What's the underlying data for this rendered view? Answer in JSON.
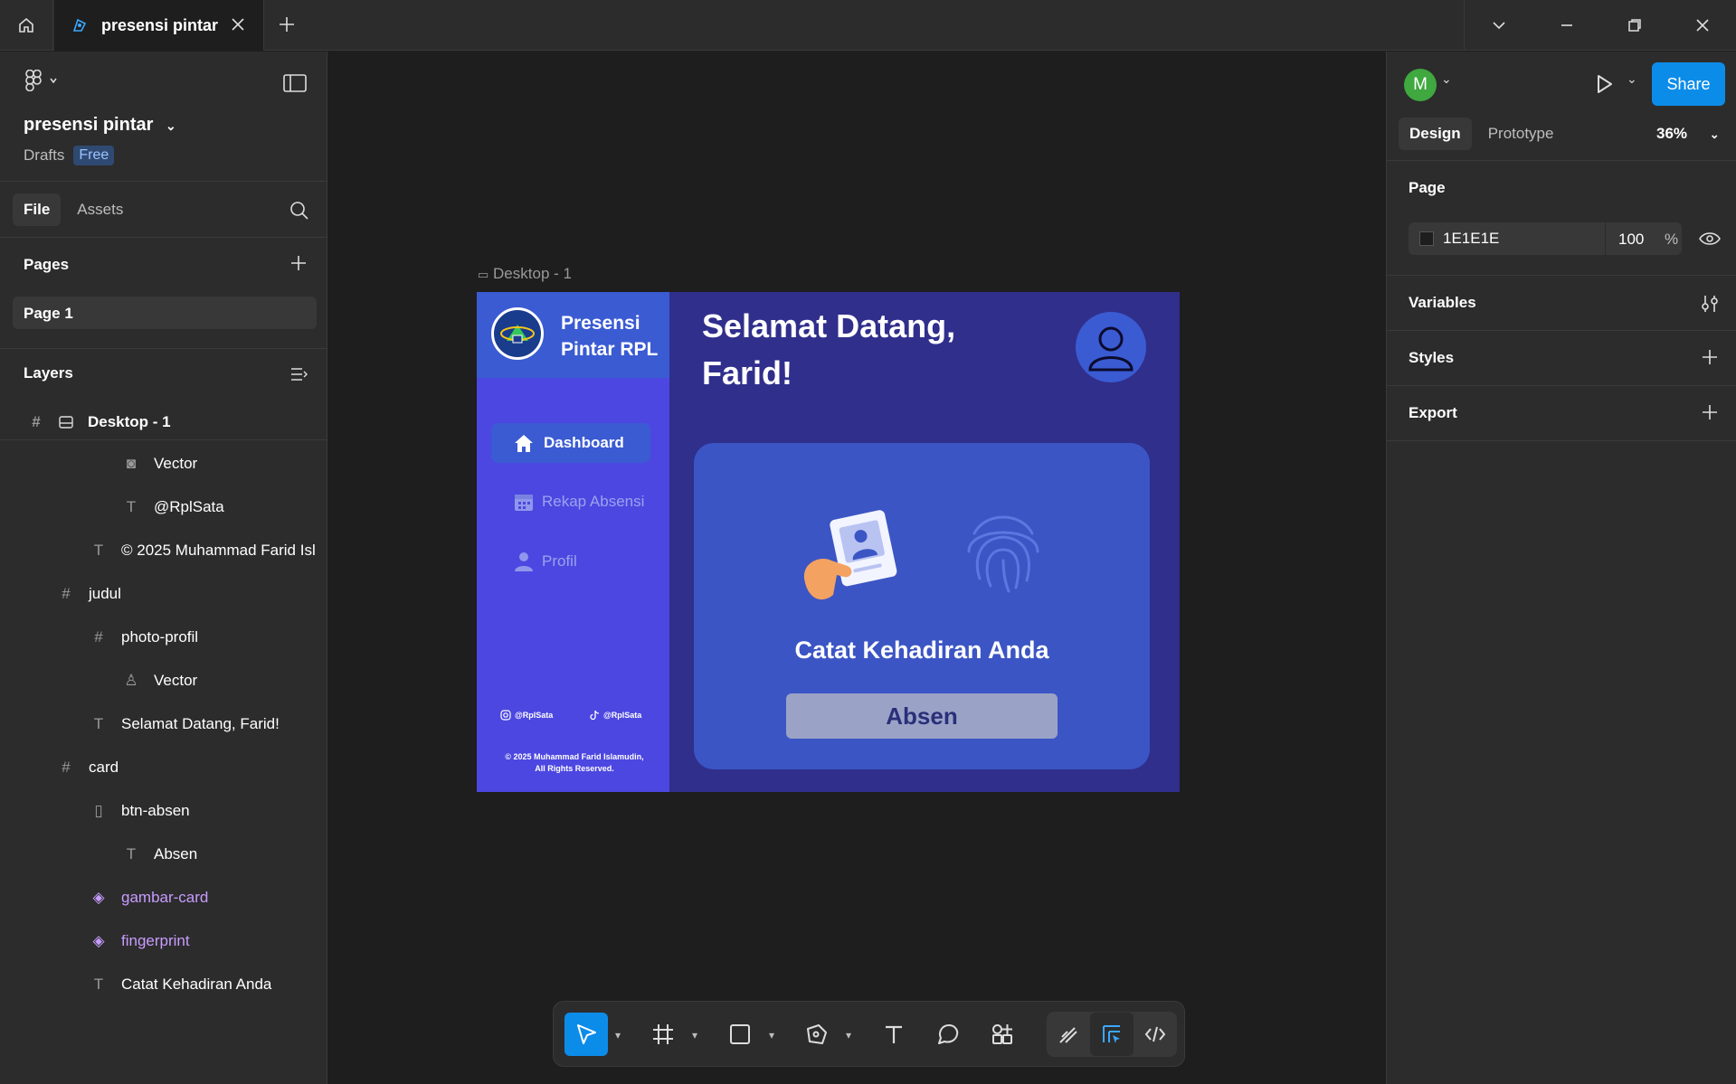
{
  "topbar": {
    "tab_title": "presensi pintar"
  },
  "left_panel": {
    "project_name": "presensi pintar",
    "location": "Drafts",
    "plan_badge": "Free",
    "tabs": [
      "File",
      "Assets"
    ],
    "pages_heading": "Pages",
    "pages": [
      "Page 1"
    ],
    "layers_heading": "Layers",
    "layers": [
      {
        "label": "Desktop - 1",
        "icon": "frame-icon"
      },
      {
        "label": "Vector",
        "icon": "instagram-icon"
      },
      {
        "label": "@RplSata",
        "icon": "text-icon"
      },
      {
        "label": "© 2025 Muhammad Farid Isl",
        "icon": "text-icon"
      },
      {
        "label": "judul",
        "icon": "frame-icon"
      },
      {
        "label": "photo-profil",
        "icon": "frame-icon"
      },
      {
        "label": "Vector",
        "icon": "user-icon"
      },
      {
        "label": "Selamat Datang, Farid!",
        "icon": "text-icon"
      },
      {
        "label": "card",
        "icon": "frame-icon"
      },
      {
        "label": "btn-absen",
        "icon": "auto-layout-icon"
      },
      {
        "label": "Absen",
        "icon": "text-icon"
      },
      {
        "label": "gambar-card",
        "icon": "component-icon"
      },
      {
        "label": "fingerprint",
        "icon": "component-icon"
      },
      {
        "label": "Catat Kehadiran Anda",
        "icon": "text-icon"
      }
    ]
  },
  "canvas": {
    "frame_label": "Desktop - 1",
    "design": {
      "brand_line1": "Presensi",
      "brand_line2": "Pintar RPL",
      "nav": [
        "Dashboard",
        "Rekap Absensi",
        "Profil"
      ],
      "social_ig": "@RplSata",
      "social_tt": "@RplSata",
      "copyright_line1": "© 2025 Muhammad Farid Islamudin,",
      "copyright_line2": "All Rights Reserved.",
      "greeting_line1": "Selamat Datang,",
      "greeting_line2": "Farid!",
      "card_title": "Catat Kehadiran Anda",
      "button_label": "Absen",
      "colors": {
        "frame_bg": "#302f8c",
        "sidebar_bg": "#4c47e0",
        "header_bg": "#3b5bd3",
        "card_bg": "#3b55c4",
        "button_bg": "#9aa3c6"
      }
    }
  },
  "right_panel": {
    "avatar_letter": "M",
    "share_label": "Share",
    "tabs": [
      "Design",
      "Prototype"
    ],
    "zoom": "36%",
    "page_heading": "Page",
    "page_fill_hex": "1E1E1E",
    "page_fill_opacity": "100",
    "percent_sign": "%",
    "variables_heading": "Variables",
    "styles_heading": "Styles",
    "export_heading": "Export"
  },
  "help_label": "?"
}
